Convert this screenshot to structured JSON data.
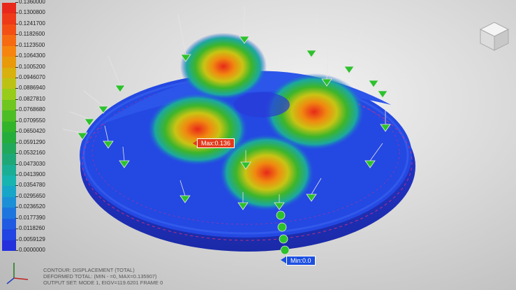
{
  "legend": {
    "values": [
      "0.1360000",
      "0.1300800",
      "0.1241700",
      "0.1182600",
      "0.1123500",
      "0.1064300",
      "0.1005200",
      "0.0946070",
      "0.0886940",
      "0.0827810",
      "0.0768680",
      "0.0709550",
      "0.0650420",
      "0.0591290",
      "0.0532160",
      "0.0473030",
      "0.0413900",
      "0.0354780",
      "0.0295650",
      "0.0236520",
      "0.0177390",
      "0.0118260",
      "0.0059129",
      "0.0000000"
    ],
    "colors": [
      "#e8281a",
      "#ee3a17",
      "#f34f14",
      "#f66a11",
      "#f5850e",
      "#e89a0b",
      "#d8b10e",
      "#bcc214",
      "#97cc1a",
      "#6fc61f",
      "#4dbd24",
      "#31b32a",
      "#25ad3c",
      "#22a85a",
      "#1fa877",
      "#1aaf95",
      "#17b4b0",
      "#18a6c8",
      "#1b90d6",
      "#1d76de",
      "#1f5be2",
      "#2144e2",
      "#2330dc",
      "#2a20d2"
    ]
  },
  "markers": {
    "max": "Max:0.136",
    "min": "Min:0.0"
  },
  "info": {
    "line1": "CONTOUR: DISPLACEMENT (TOTAL)",
    "line2": "DEFORMED TOTAL: (MIN - =0, MAX=0.135907)",
    "line3": "OUTPUT SET: MODE 1, EIGV=119.6201   FRAME    0"
  },
  "icons": {
    "view_cube": "view-cube-icon",
    "axis_triad": "axis-triad-icon"
  }
}
